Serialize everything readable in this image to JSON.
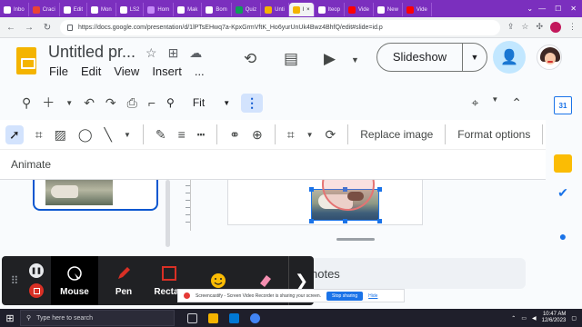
{
  "browser": {
    "tabs": [
      {
        "label": "Inbo",
        "color": "#ffffff"
      },
      {
        "label": "Craci",
        "color": "#ea4335"
      },
      {
        "label": "Edit",
        "color": "#ffffff"
      },
      {
        "label": "Mon",
        "color": "#ffffff"
      },
      {
        "label": "LS2",
        "color": "#ffffff"
      },
      {
        "label": "Hom",
        "color": "#7b2fbe"
      },
      {
        "label": "Mak",
        "color": "#ffffff"
      },
      {
        "label": "Bom",
        "color": "#ffffff"
      },
      {
        "label": "Quiz",
        "color": "#0f9d58"
      },
      {
        "label": "Unti",
        "color": "#f4b400"
      },
      {
        "label": "l",
        "color": "#f4b400"
      },
      {
        "label": "Iteop",
        "color": "#ffffff"
      },
      {
        "label": "Vide",
        "color": "#ff0000"
      },
      {
        "label": "New",
        "color": "#ffffff"
      },
      {
        "label": "Vide",
        "color": "#ff0000"
      }
    ],
    "url": "https://docs.google.com/presentation/d/1lPTsEHwq7a-KpxGrmVftK_Ho6yurUnUk4Bwz4BhfQ/edit#slide=id.p"
  },
  "doc": {
    "title": "Untitled pr...",
    "menu": [
      "File",
      "Edit",
      "View",
      "Insert",
      "..."
    ],
    "slideshow_label": "Slideshow"
  },
  "toolbar1": {
    "zoom_label": "Fit"
  },
  "toolbar2": {
    "replace_image": "Replace image",
    "format_options": "Format options",
    "animate": "Animate"
  },
  "sidepanel": {
    "calendar_day": "31"
  },
  "canvas": {
    "notes_label": "notes"
  },
  "screencastify": {
    "tools": [
      {
        "label": "Mouse",
        "icon": "mouse-cursor-icon",
        "active": true
      },
      {
        "label": "Pen",
        "icon": "pen-icon",
        "active": false
      },
      {
        "label": "Rectan",
        "icon": "rectangle-icon",
        "active": false
      },
      {
        "label": "",
        "icon": "sticker-icon",
        "active": false
      },
      {
        "label": "",
        "icon": "eraser-icon",
        "active": false
      }
    ],
    "banner_text": "Screencastify - Screen Video Recorder is sharing your screen.",
    "stop_label": "Stop sharing",
    "hide_label": "Hide"
  },
  "taskbar": {
    "search_placeholder": "Type here to search",
    "time": "10:47 AM",
    "date": "12/6/2023"
  },
  "colors": {
    "accent_blue": "#1a73e8",
    "tab_strip": "#7b2fbe",
    "record_red": "#d93025"
  }
}
